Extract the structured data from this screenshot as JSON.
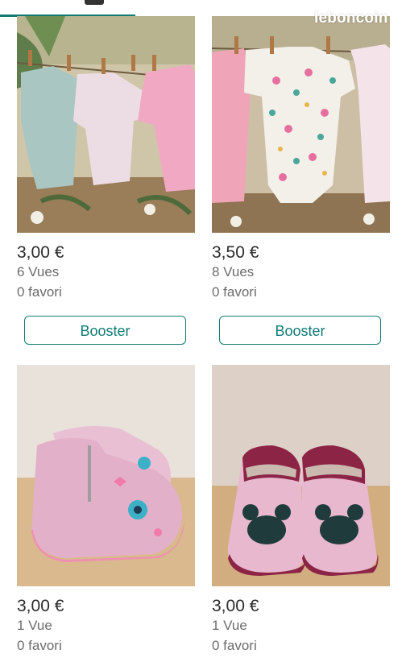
{
  "brand": "leboncoin",
  "colors": {
    "accent": "#0f7b74",
    "text": "#2c2c2c",
    "muted": "#6c6c6c"
  },
  "listings": [
    {
      "price": "3,00 €",
      "views": "6 Vues",
      "favorites": "0 favori",
      "action_label": "Booster"
    },
    {
      "price": "3,50 €",
      "views": "8 Vues",
      "favorites": "0 favori",
      "action_label": "Booster"
    },
    {
      "price": "3,00 €",
      "views": "1 Vue",
      "favorites": "0 favori"
    },
    {
      "price": "3,00 €",
      "views": "1 Vue",
      "favorites": "0 favori"
    }
  ]
}
